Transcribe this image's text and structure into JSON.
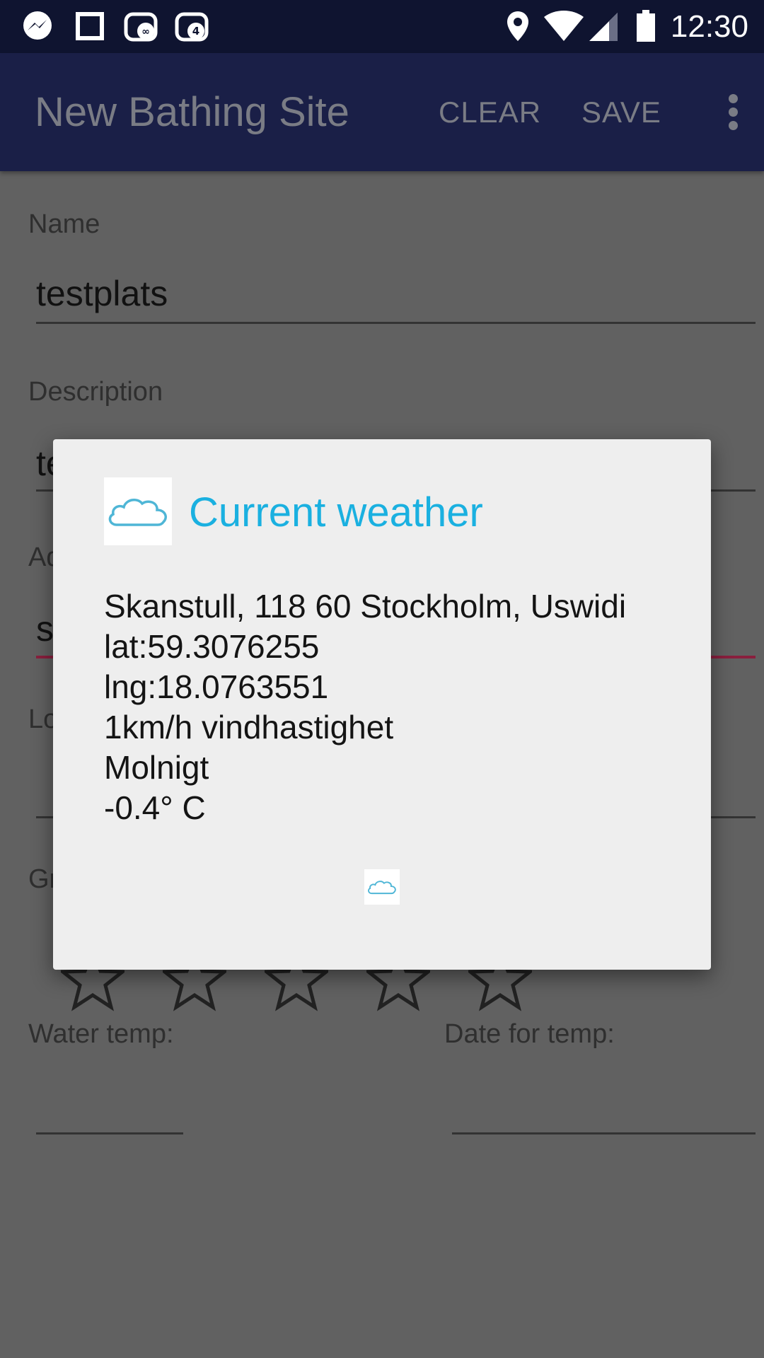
{
  "status_bar": {
    "time": "12:30",
    "icons": [
      "messenger-icon",
      "square-icon",
      "pig-infinity-icon",
      "notification-count-icon",
      "location-icon",
      "wifi-icon",
      "signal-icon",
      "battery-icon"
    ],
    "notification_count": "4"
  },
  "app_bar": {
    "title": "New Bathing Site",
    "clear_label": "CLEAR",
    "save_label": "SAVE",
    "overflow_icon": "more-vert-icon"
  },
  "form": {
    "name_label": "Name",
    "name_value": "testplats",
    "description_label": "Description",
    "description_value": "te",
    "address_label": "Ad",
    "address_value": "s",
    "longitude_label": "Lo",
    "grade_label": "Gr",
    "grade_stars": 0,
    "water_temp_label": "Water temp:",
    "date_for_temp_label": "Date for temp:"
  },
  "dialog": {
    "title": "Current weather",
    "icon": "cloud-icon",
    "address": "Skanstull, 118 60 Stockholm, Uswidi",
    "lat": "lat:59.3076255",
    "lng": "lng:18.0763551",
    "wind": "1km/h vindhastighet",
    "condition": "Molnigt",
    "temperature": "-0.4° C"
  },
  "colors": {
    "status_bar_bg": "#0f1430",
    "app_bar_bg": "#1a1f47",
    "dialog_title": "#1ab0e0",
    "scrim": "#616161",
    "active_underline": "#8a1f3e"
  }
}
